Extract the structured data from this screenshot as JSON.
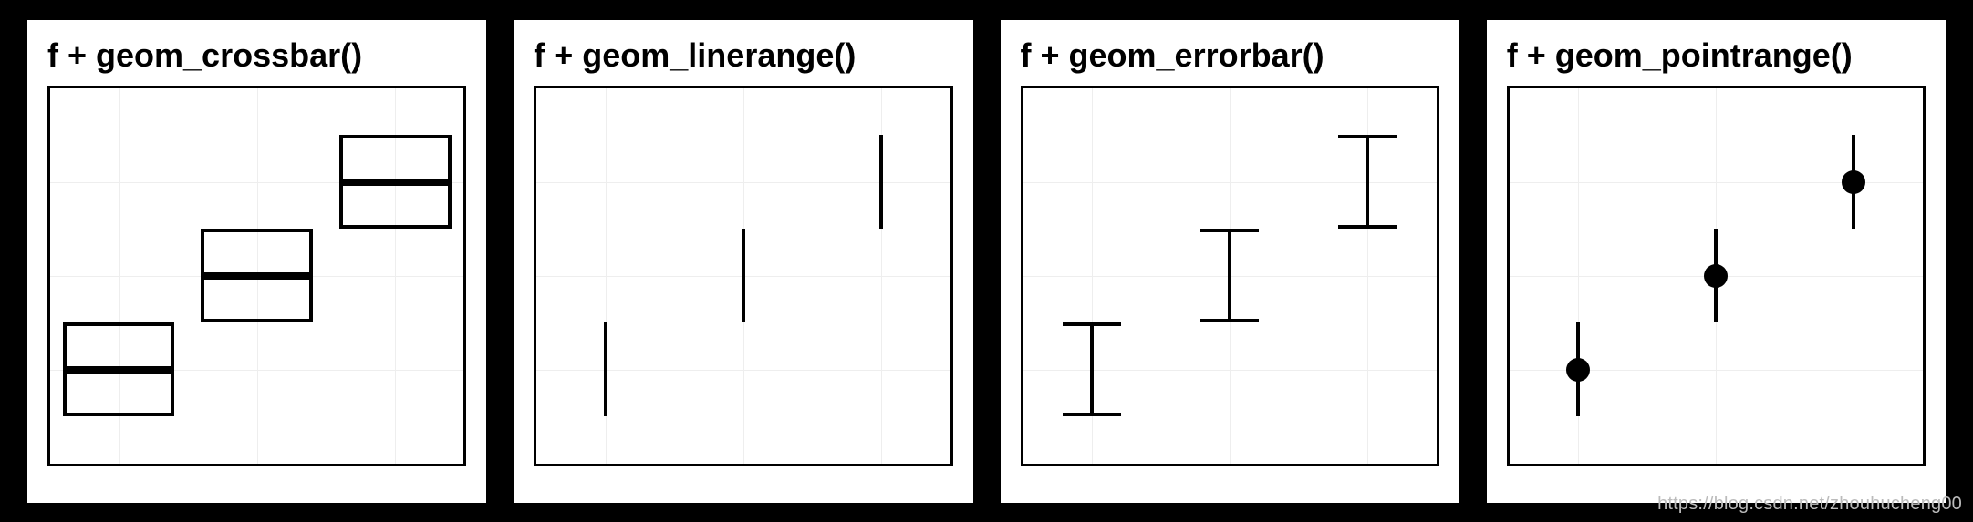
{
  "panels": [
    {
      "id": "crossbar",
      "title": "f + geom_crossbar()"
    },
    {
      "id": "linerange",
      "title": "f + geom_linerange()"
    },
    {
      "id": "errorbar",
      "title": "f + geom_errorbar()"
    },
    {
      "id": "pointrange",
      "title": "f + geom_pointrange()"
    }
  ],
  "watermark": "https://blog.csdn.net/zhouhucheng00",
  "chart_data": [
    {
      "type": "crossbar",
      "title": "f + geom_crossbar()",
      "x": [
        1,
        2,
        3
      ],
      "ymin": [
        1.0,
        2.0,
        3.0
      ],
      "y": [
        1.5,
        2.5,
        3.5
      ],
      "ymax": [
        2.0,
        3.0,
        4.0
      ],
      "xlim": [
        0.5,
        3.5
      ],
      "ylim": [
        0.5,
        4.5
      ]
    },
    {
      "type": "linerange",
      "title": "f + geom_linerange()",
      "x": [
        1,
        2,
        3
      ],
      "ymin": [
        1.0,
        2.0,
        3.0
      ],
      "ymax": [
        2.0,
        3.0,
        4.0
      ],
      "xlim": [
        0.5,
        3.5
      ],
      "ylim": [
        0.5,
        4.5
      ]
    },
    {
      "type": "errorbar",
      "title": "f + geom_errorbar()",
      "x": [
        1,
        2,
        3
      ],
      "ymin": [
        1.0,
        2.0,
        3.0
      ],
      "ymax": [
        2.0,
        3.0,
        4.0
      ],
      "xlim": [
        0.5,
        3.5
      ],
      "ylim": [
        0.5,
        4.5
      ]
    },
    {
      "type": "pointrange",
      "title": "f + geom_pointrange()",
      "x": [
        1,
        2,
        3
      ],
      "ymin": [
        1.0,
        2.0,
        3.0
      ],
      "y": [
        1.5,
        2.5,
        3.5
      ],
      "ymax": [
        2.0,
        3.0,
        4.0
      ],
      "xlim": [
        0.5,
        3.5
      ],
      "ylim": [
        0.5,
        4.5
      ]
    }
  ]
}
